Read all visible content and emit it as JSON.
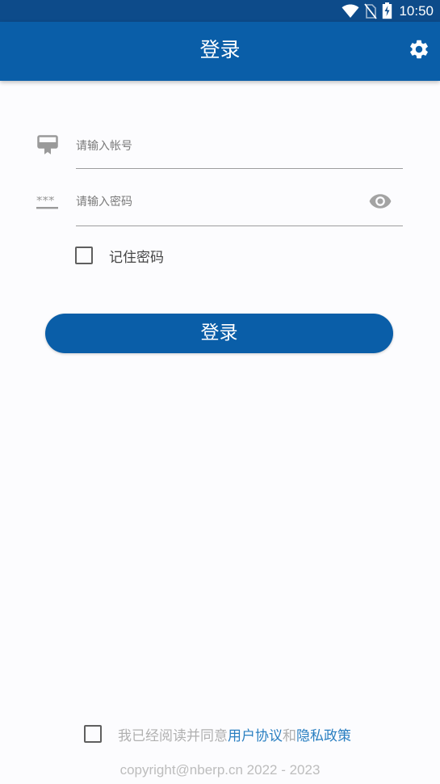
{
  "status_bar": {
    "time": "10:50",
    "icons": [
      "wifi-icon",
      "no-sim-icon",
      "battery-charging-icon"
    ]
  },
  "app_bar": {
    "title": "登录",
    "settings_icon": "gear-icon"
  },
  "form": {
    "account": {
      "placeholder": "请输入帐号",
      "value": "",
      "icon": "account-card-icon"
    },
    "password": {
      "placeholder": "请输入密码",
      "value": "",
      "icon": "password-dots-icon",
      "toggle_icon": "eye-icon"
    },
    "remember_label": "记住密码",
    "remember_checked": false,
    "login_label": "登录"
  },
  "agreement": {
    "checked": false,
    "prefix": "我已经阅读并同意",
    "user_agreement": "用户协议",
    "conjunction": "和",
    "privacy_policy": "隐私政策"
  },
  "footer": {
    "copyright": "copyright@nberp.cn 2022 - 2023"
  },
  "colors": {
    "primary": "#0a5ea8",
    "status_bar": "#0d4b8a",
    "link": "#2a7fc1",
    "background": "#fcfcfe"
  }
}
